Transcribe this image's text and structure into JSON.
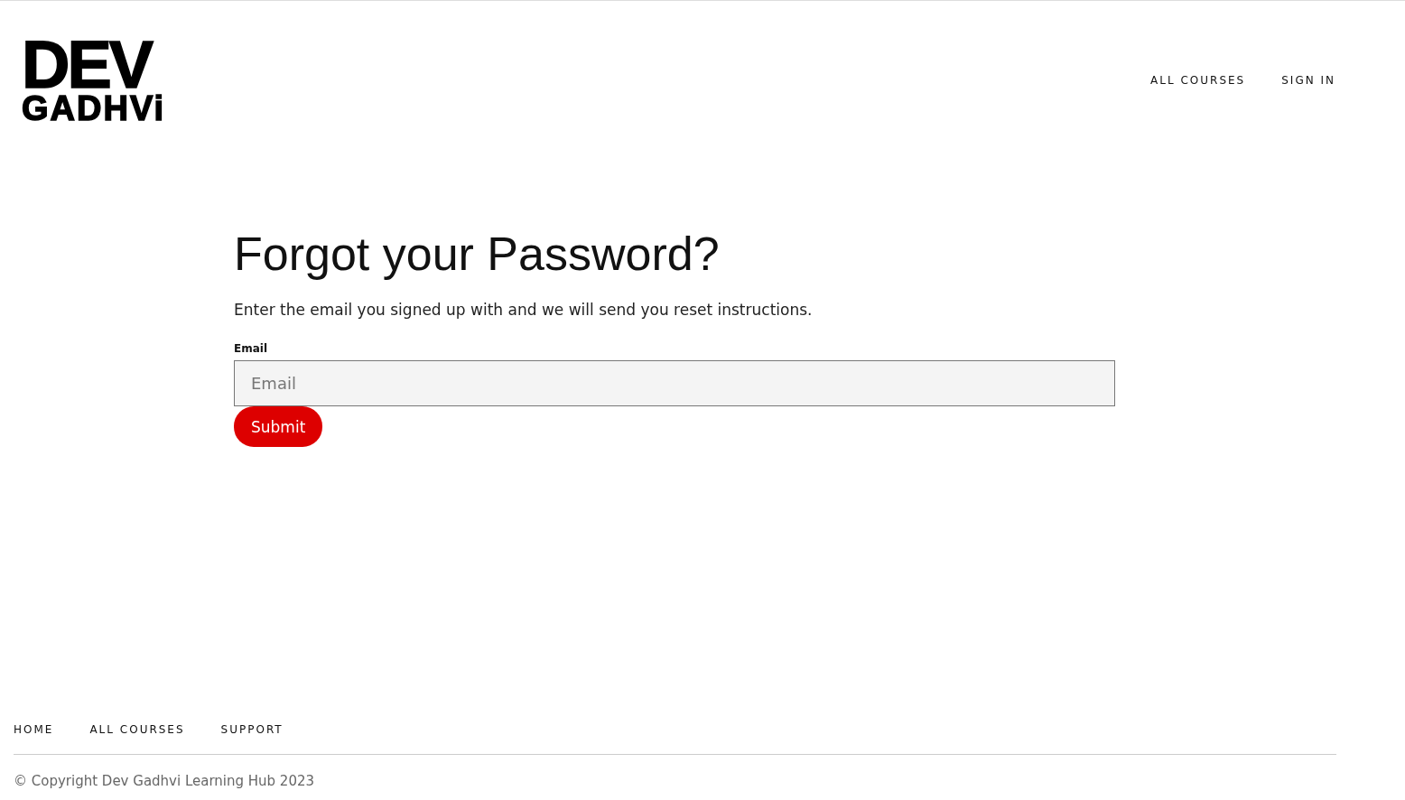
{
  "logo": {
    "lines": [
      "DEV",
      "GADHVi"
    ]
  },
  "header_nav": [
    "ALL COURSES",
    "SIGN IN"
  ],
  "form": {
    "title": "Forgot your Password?",
    "description": "Enter the email you signed up with and we will send you reset instructions.",
    "email_label": "Email",
    "email_placeholder": "Email",
    "submit": "Submit"
  },
  "footer_nav": [
    "HOME",
    "ALL COURSES",
    "SUPPORT"
  ],
  "copyright": "© Copyright Dev Gadhvi Learning Hub 2023"
}
